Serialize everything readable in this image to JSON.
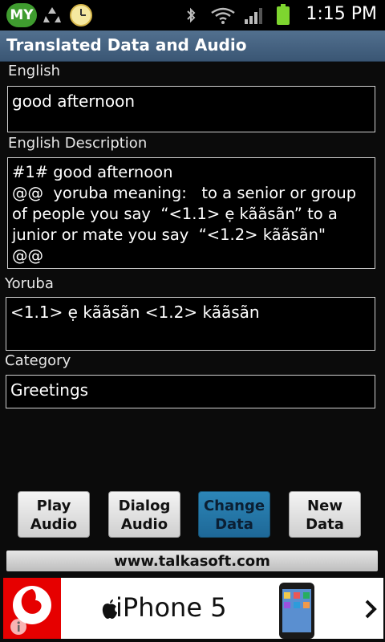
{
  "status_bar": {
    "carrier_badge": "MY",
    "time": "1:15 PM",
    "icons": [
      "recycle-icon",
      "clock-icon",
      "bluetooth-icon",
      "wifi-icon",
      "signal-icon",
      "battery-icon"
    ]
  },
  "title_bar": {
    "title": "Translated Data and Audio"
  },
  "fields": {
    "english": {
      "label": "English",
      "value": "good afternoon"
    },
    "english_description": {
      "label": "English Description",
      "value": "#1# good afternoon\n@@  yoruba meaning:   to a senior or group of people you say  “<1.1> ẹ kããsãn” to a junior or mate you say  “<1.2> kããsãn\"   @@"
    },
    "yoruba": {
      "label": "Yoruba",
      "value": "<1.1> ẹ kããsãn <1.2> kããsãn"
    },
    "category": {
      "label": "Category",
      "value": "Greetings"
    }
  },
  "buttons": {
    "play_audio": "Play\nAudio",
    "dialog_audio": "Dialog\nAudio",
    "change_data": "Change\nData",
    "new_data": "New\nData"
  },
  "link_bar": {
    "text": "www.talkasoft.com"
  },
  "ad": {
    "text": "iPhone 5",
    "brand_color": "#e60000"
  },
  "colors": {
    "title_bar": "#3f5b78",
    "active_button": "#1e77aa",
    "background": "#0b0b0b"
  }
}
